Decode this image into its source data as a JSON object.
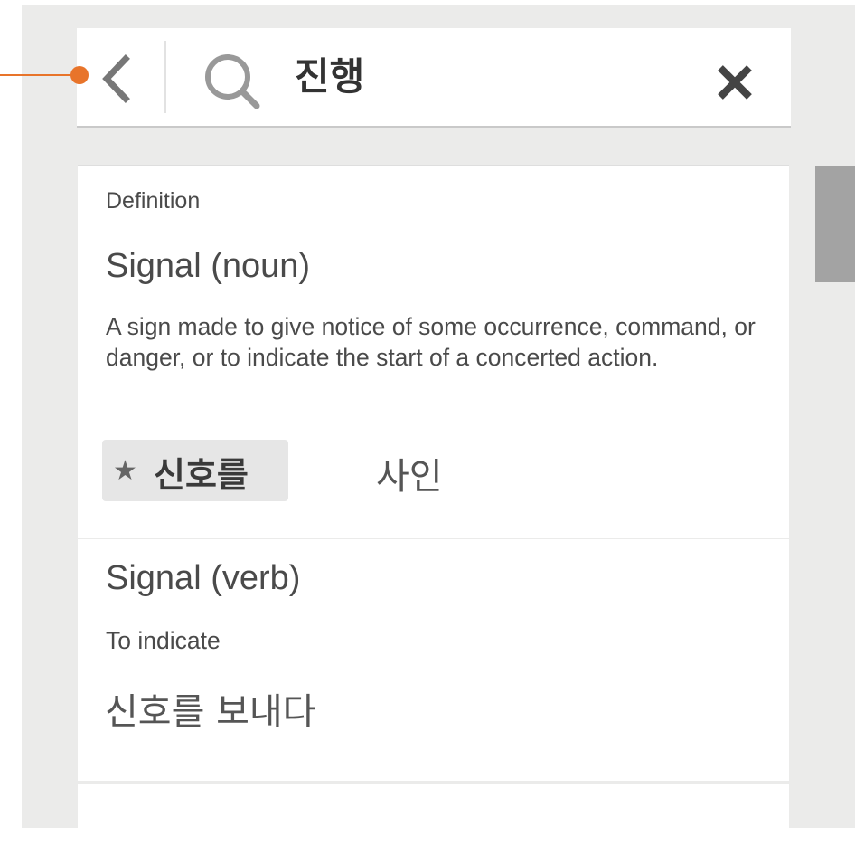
{
  "search": {
    "query": "진행"
  },
  "results": {
    "section_label": "Definition",
    "entries": [
      {
        "title": "Signal (noun)",
        "description": "A sign made to give notice of some occurrence, command, or danger, or to indicate the start of a concerted action.",
        "primary_translation": "신호를",
        "star_glyph": "★",
        "alt_translation": "사인"
      },
      {
        "title": "Signal (verb)",
        "description": "To indicate",
        "translation": "신호를 보내다"
      }
    ]
  },
  "icons": {
    "back": "chevron-left-icon",
    "search": "search-icon",
    "clear": "close-icon",
    "favorite": "star-icon"
  },
  "colors": {
    "annotation": "#e8742a",
    "background": "#ebebea",
    "card": "#ffffff",
    "text": "#4a4a4a",
    "chip": "#e6e6e6",
    "scrollbar": "#a3a3a3"
  }
}
